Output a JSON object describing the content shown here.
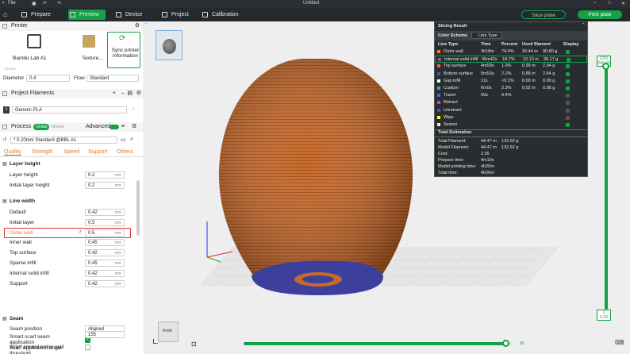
{
  "titlebar": {
    "menu_label": "File",
    "doc_title": "Untitled"
  },
  "tabs": [
    {
      "label": "Prepare"
    },
    {
      "label": "Preview",
      "active": true
    },
    {
      "label": "Device"
    },
    {
      "label": "Project"
    },
    {
      "label": "Calibration"
    }
  ],
  "actions": {
    "slice_label": "Slice plate",
    "print_label": "Print plate"
  },
  "printer": {
    "section_title": "Printer",
    "name": "Bambu Lab A1",
    "plate_label": "Texture...",
    "sync_label": "Sync printer information",
    "nozzle_label": "Nozzle",
    "diameter_label": "Diameter",
    "diameter_value": "0.4",
    "flow_label": "Flow",
    "flow_value": "Standard"
  },
  "filaments": {
    "section_title": "Project Filaments",
    "slot": "1",
    "name": "Generic PLA"
  },
  "process": {
    "section_title": "Process",
    "global_label": "Global",
    "objects_label": "Objects",
    "advanced_label": "Advanced",
    "preset": "* 0.20mm Standard @BBL A1",
    "tabs": [
      "Quality",
      "Strength",
      "Speed",
      "Support",
      "Others"
    ]
  },
  "layer_height": {
    "title": "Layer height",
    "rows": [
      {
        "label": "Layer height",
        "value": "0.2",
        "unit": "mm"
      },
      {
        "label": "Initial layer height",
        "value": "0.2",
        "unit": "mm"
      }
    ]
  },
  "line_width": {
    "title": "Line width",
    "rows": [
      {
        "label": "Default",
        "value": "0.42",
        "unit": "mm"
      },
      {
        "label": "Initial layer",
        "value": "0.5",
        "unit": "mm"
      },
      {
        "label": "Outer wall",
        "value": "0.5",
        "unit": "mm",
        "highlighted": true
      },
      {
        "label": "Inner wall",
        "value": "0.45",
        "unit": "mm"
      },
      {
        "label": "Top surface",
        "value": "0.42",
        "unit": "mm"
      },
      {
        "label": "Sparse infill",
        "value": "0.45",
        "unit": "mm"
      },
      {
        "label": "Internal solid infill",
        "value": "0.42",
        "unit": "mm"
      },
      {
        "label": "Support",
        "value": "0.42",
        "unit": "mm"
      }
    ]
  },
  "seam": {
    "title": "Seam",
    "position_label": "Seam position",
    "position_value": "Aligned",
    "scarf_label": "Smart scarf seam application",
    "scarf_checked": true,
    "angle_label": "Scarf application angle threshold",
    "angle_value": "155",
    "around_label": "Scarf around entire wall"
  },
  "slicing_result": {
    "title": "Slicing Result",
    "scheme_label": "Color Scheme",
    "scheme_value": "Line Type",
    "headers": [
      "Line Type",
      "Time",
      "Percent",
      "Used filament",
      "Display"
    ],
    "rows": [
      {
        "type": "Outer wall",
        "time": "3h18m",
        "percent": "74.4%",
        "length": "30.44 m",
        "weight": "90.80 g",
        "color": "#ff7f00",
        "display": true
      },
      {
        "type": "Internal solid infill",
        "time": "49m42s",
        "percent": "18.7%",
        "length": "12.13 m",
        "weight": "36.17 g",
        "color": "#9a4f9e",
        "display": true
      },
      {
        "type": "Top surface",
        "time": "4m59s",
        "percent": "1.9%",
        "length": "0.99 m",
        "weight": "2.94 g",
        "color": "#ff5050",
        "display": true
      },
      {
        "type": "Bottom surface",
        "time": "5m53s",
        "percent": "2.2%",
        "length": "0.88 m",
        "weight": "2.64 g",
        "color": "#4f56c8",
        "display": true
      },
      {
        "type": "Gap infill",
        "time": "11s",
        "percent": "<0.1%",
        "length": "0.00 m",
        "weight": "0.00 g",
        "color": "#ffffff",
        "display": true
      },
      {
        "type": "Custom",
        "time": "6m0s",
        "percent": "2.3%",
        "length": "0.02 m",
        "weight": "0.06 g",
        "color": "#2fb894",
        "display": true
      },
      {
        "type": "Travel",
        "time": "59s",
        "percent": "0.4%",
        "length": "",
        "weight": "",
        "color": "#3c6ee6",
        "display": false
      },
      {
        "type": "Retract",
        "time": "",
        "percent": "",
        "length": "",
        "weight": "",
        "color": "#d236d2",
        "display": false
      },
      {
        "type": "Unretract",
        "time": "",
        "percent": "",
        "length": "",
        "weight": "",
        "color": "#4646ff",
        "display": false
      },
      {
        "type": "Wipe",
        "time": "",
        "percent": "",
        "length": "",
        "weight": "",
        "color": "#ffff00",
        "display": false
      },
      {
        "type": "Seams",
        "time": "",
        "percent": "",
        "length": "",
        "weight": "",
        "color": "#e6e6e6",
        "display": true
      }
    ],
    "estimation_title": "Total Estimation",
    "estimation": [
      {
        "label": "Total Filament:",
        "v1": "44.47 m",
        "v2": "132.62 g"
      },
      {
        "label": "Model Filament:",
        "v1": "44.47 m",
        "v2": "132.62 g"
      },
      {
        "label": "Cost:",
        "v1": "2.65",
        "v2": ""
      },
      {
        "label": "Prepare time:",
        "v1": "4m19s",
        "v2": ""
      },
      {
        "label": "Model printing time:",
        "v1": "4h20m",
        "v2": ""
      },
      {
        "label": "Total time:",
        "v1": "4h26m",
        "v2": ""
      }
    ]
  },
  "layer_slider": {
    "top_value": "1201",
    "top_height": "240.00",
    "bottom_value": "1",
    "bottom_height": "0.20"
  },
  "move_slider": {
    "value": "95",
    "fraction": 0.98
  },
  "view_cube": {
    "label": "Front"
  },
  "colors": {
    "accent": "#14a046",
    "model": "#c8692a",
    "bottom": "#3c3f9c"
  }
}
